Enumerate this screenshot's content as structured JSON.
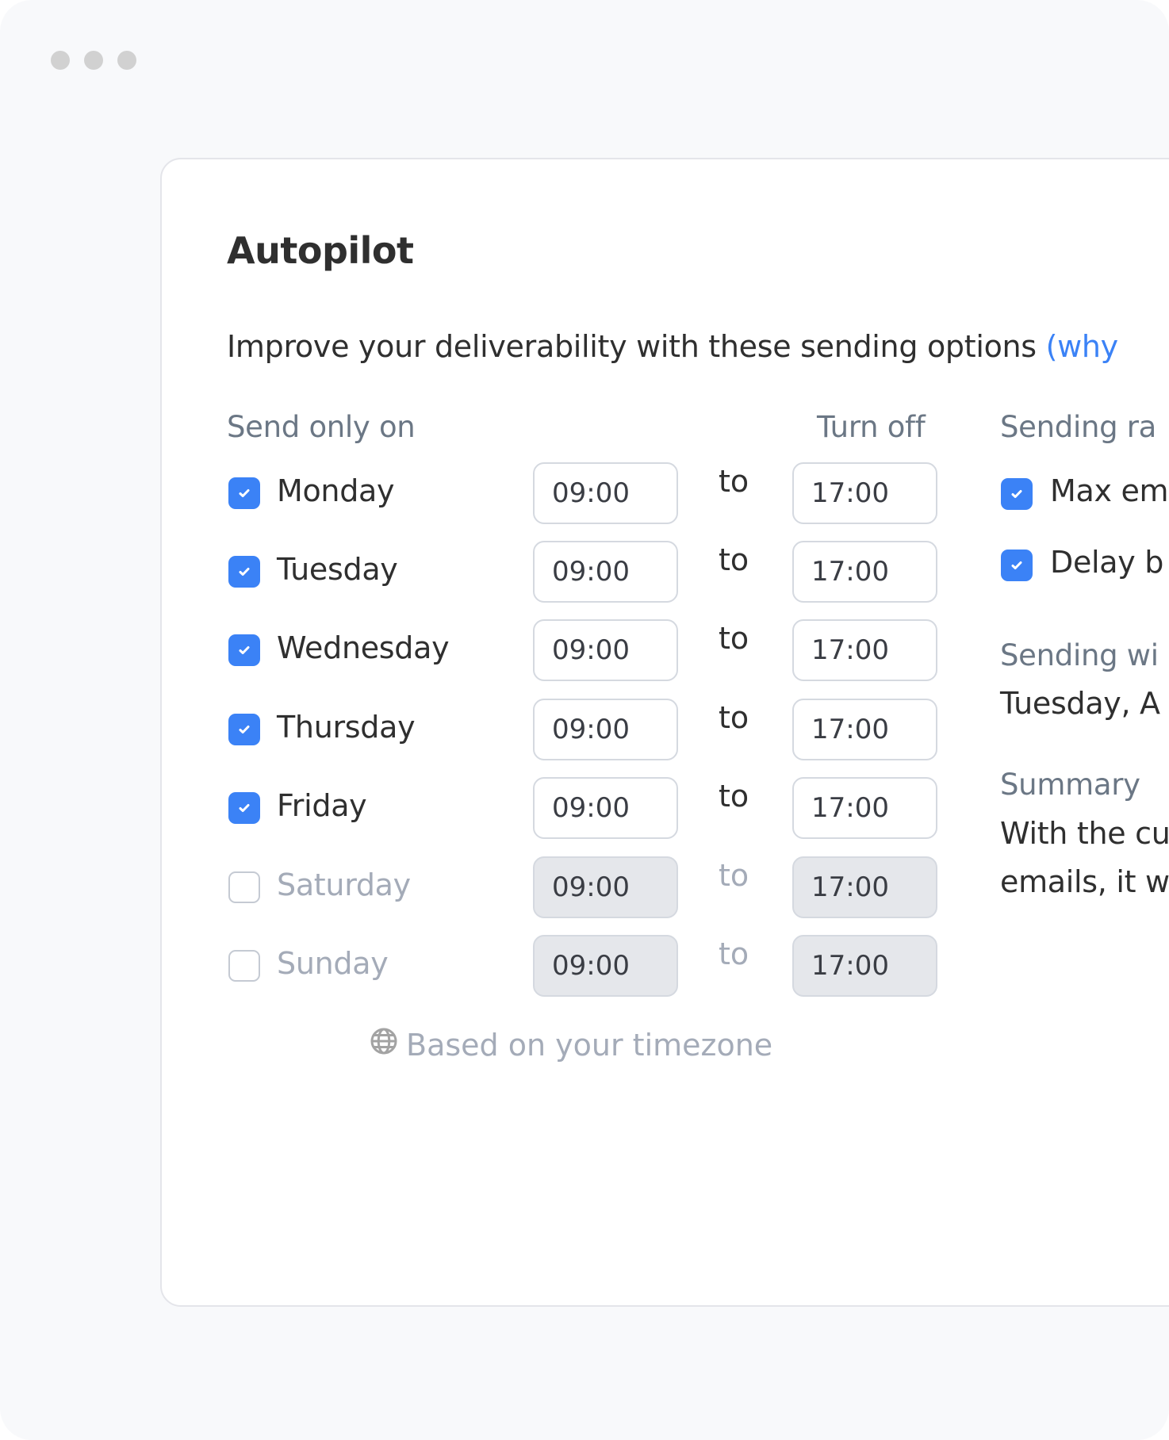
{
  "window": {
    "controls": [
      "dot",
      "dot",
      "dot"
    ]
  },
  "card": {
    "title": "Autopilot",
    "subtitle": "Improve your deliverability with these sending options ",
    "subtitle_link": "(why",
    "schedule": {
      "heading": "Send only on",
      "turn_off_heading": "Turn off",
      "to_label": "to",
      "days": [
        {
          "name": "Monday",
          "checked": true,
          "from": "09:00",
          "to": "17:00"
        },
        {
          "name": "Tuesday",
          "checked": true,
          "from": "09:00",
          "to": "17:00"
        },
        {
          "name": "Wednesday",
          "checked": true,
          "from": "09:00",
          "to": "17:00"
        },
        {
          "name": "Thursday",
          "checked": true,
          "from": "09:00",
          "to": "17:00"
        },
        {
          "name": "Friday",
          "checked": true,
          "from": "09:00",
          "to": "17:00"
        },
        {
          "name": "Saturday",
          "checked": false,
          "from": "09:00",
          "to": "17:00"
        },
        {
          "name": "Sunday",
          "checked": false,
          "from": "09:00",
          "to": "17:00"
        }
      ],
      "timezone_note": "Based on your timezone",
      "timezone_icon": "globe-icon"
    },
    "sending_rate": {
      "heading": "Sending ra",
      "options": [
        {
          "label": "Max em",
          "checked": true
        },
        {
          "label": "Delay b",
          "checked": true
        }
      ]
    },
    "sending_window": {
      "heading": "Sending wi",
      "value": "Tuesday, A"
    },
    "summary": {
      "heading": "Summary",
      "line1": "With the cu",
      "line2": "emails, it w"
    }
  },
  "colors": {
    "accent": "#3b82f6",
    "text": "#2f2f2f",
    "muted": "#6b7785",
    "disabled": "#a4abb8",
    "background": "#f8f9fb"
  }
}
